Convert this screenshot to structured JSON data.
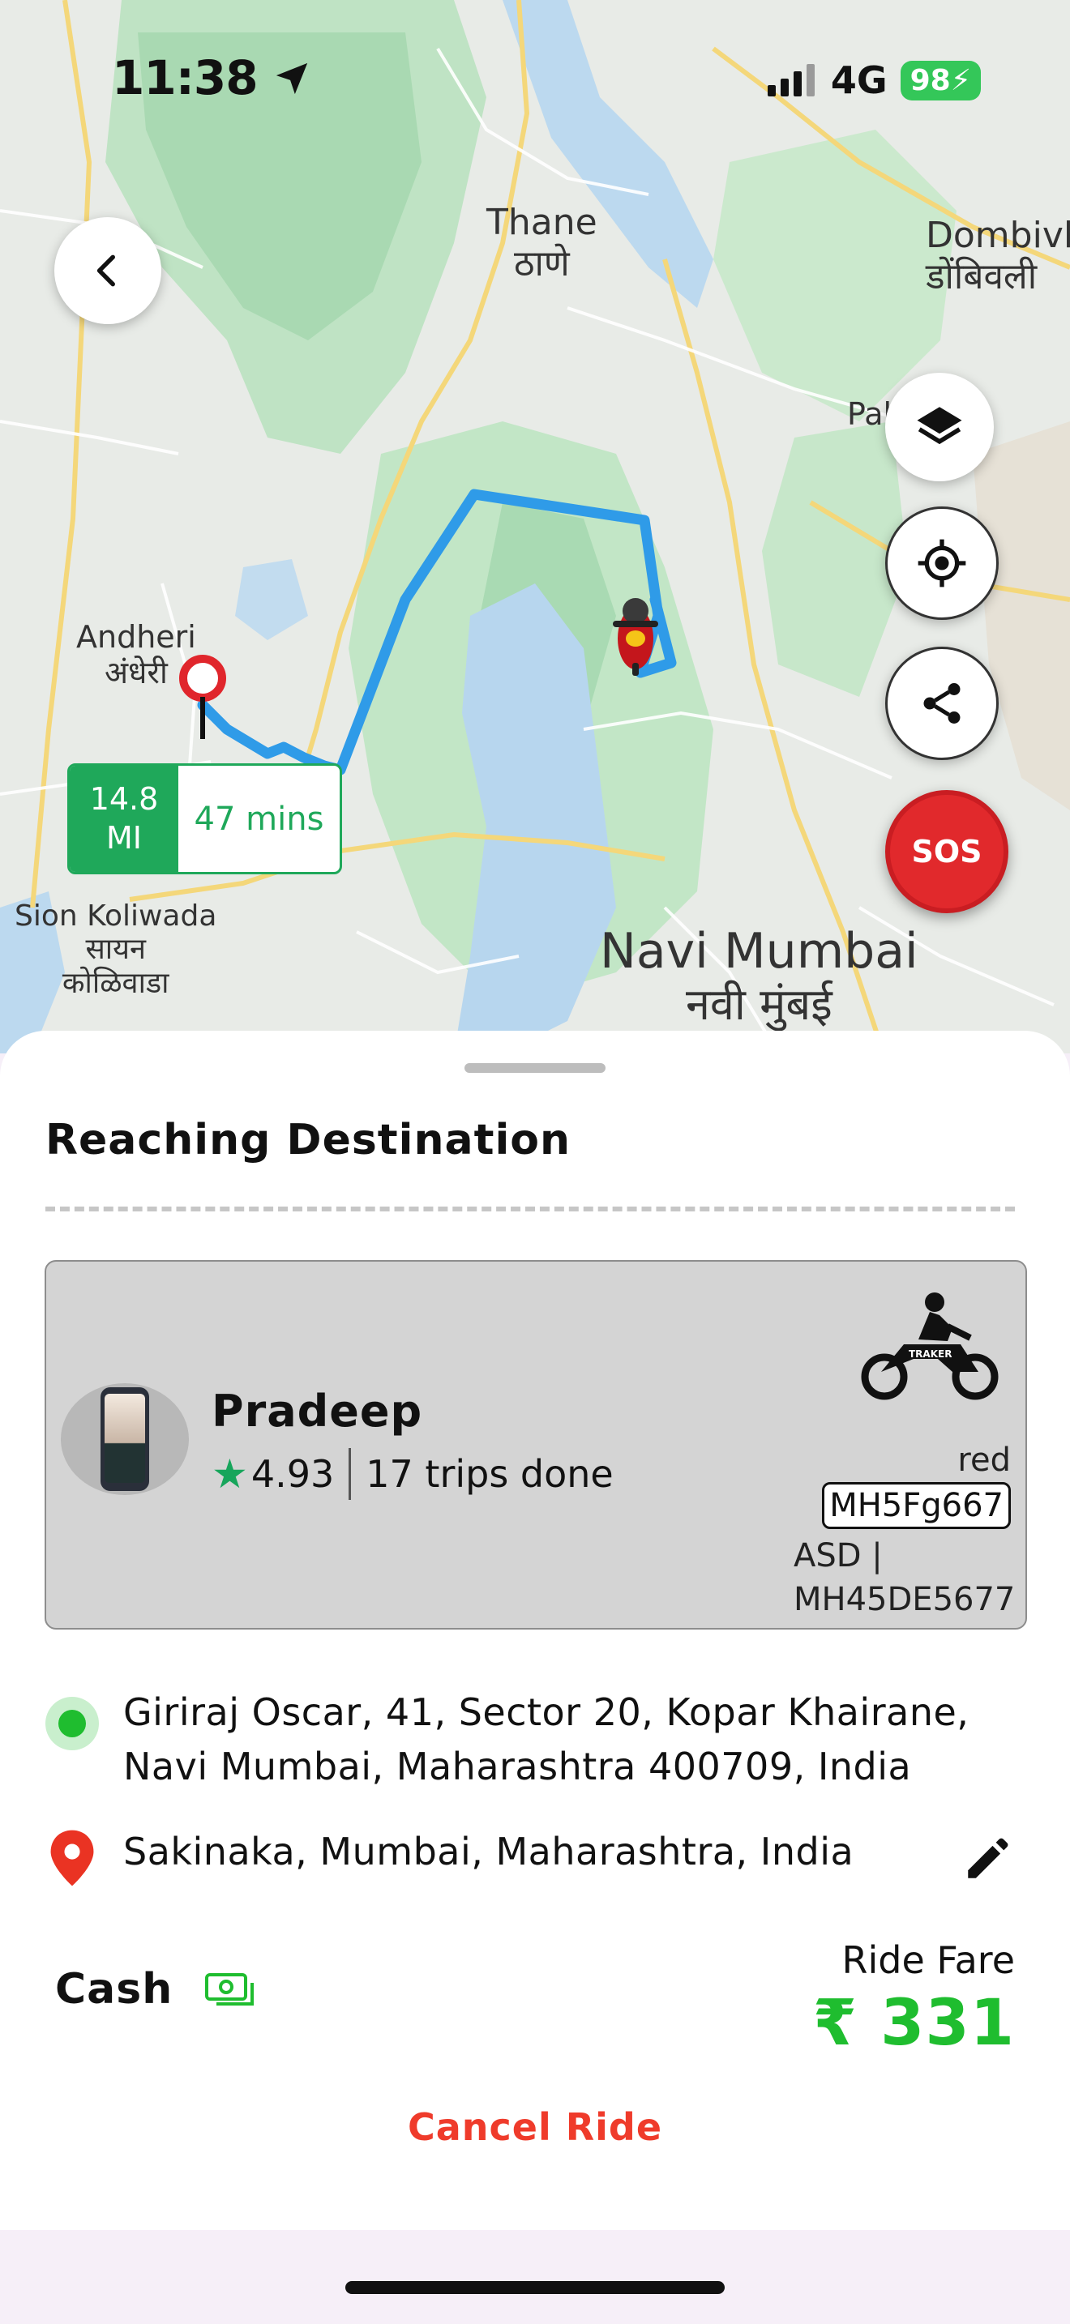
{
  "status_bar": {
    "time": "11:38",
    "network": "4G",
    "battery": "98"
  },
  "map": {
    "labels": {
      "thane_en": "Thane",
      "thane_mr": "ठाणे",
      "dombivli_en": "Dombivl",
      "dombivli_mr": "डोंबिवली",
      "andheri_en": "Andheri",
      "andheri_mr": "अंधेरी",
      "sion_en": "Sion Koliwada",
      "sion_mr1": "सायन",
      "sion_mr2": "कोळिवाडा",
      "navi_en": "Navi Mumbai",
      "navi_mr": "नवी मुंबई",
      "palava": "Pal"
    },
    "eta": {
      "distance_value": "14.8",
      "distance_unit": "MI",
      "time": "47 mins"
    },
    "sos_label": "SOS"
  },
  "sheet": {
    "title": "Reaching Destination",
    "driver": {
      "name": "Pradeep",
      "rating": "4.93",
      "trips": "17 trips done",
      "vehicle_color": "red",
      "plate": "MH5Fg667",
      "model_line1": "ASD |",
      "model_line2": "MH45DE5677",
      "bike_brand": "TRAKER"
    },
    "pickup": {
      "line1": "Giriraj Oscar, 41, Sector 20, Kopar Khairane,",
      "line2": "Navi Mumbai, Maharashtra 400709, India"
    },
    "dropoff": {
      "text": "Sakinaka, Mumbai, Maharashtra, India"
    },
    "payment": {
      "method": "Cash"
    },
    "fare": {
      "label": "Ride Fare",
      "value": "₹ 331"
    },
    "cancel_label": "Cancel Ride"
  },
  "colors": {
    "accent_green": "#1fbd2f",
    "route_blue": "#2f9be8",
    "sos_red": "#e1292c",
    "cancel_red": "#ef3b2b"
  },
  "icons": [
    "back-chevron-icon",
    "layers-icon",
    "locate-icon",
    "share-icon",
    "destination-pin-icon",
    "scooter-marker-icon",
    "motorbike-icon",
    "pickup-dot-icon",
    "drop-pin-icon",
    "edit-pencil-icon",
    "cash-icon",
    "star-icon",
    "location-arrow-icon",
    "signal-icon"
  ]
}
